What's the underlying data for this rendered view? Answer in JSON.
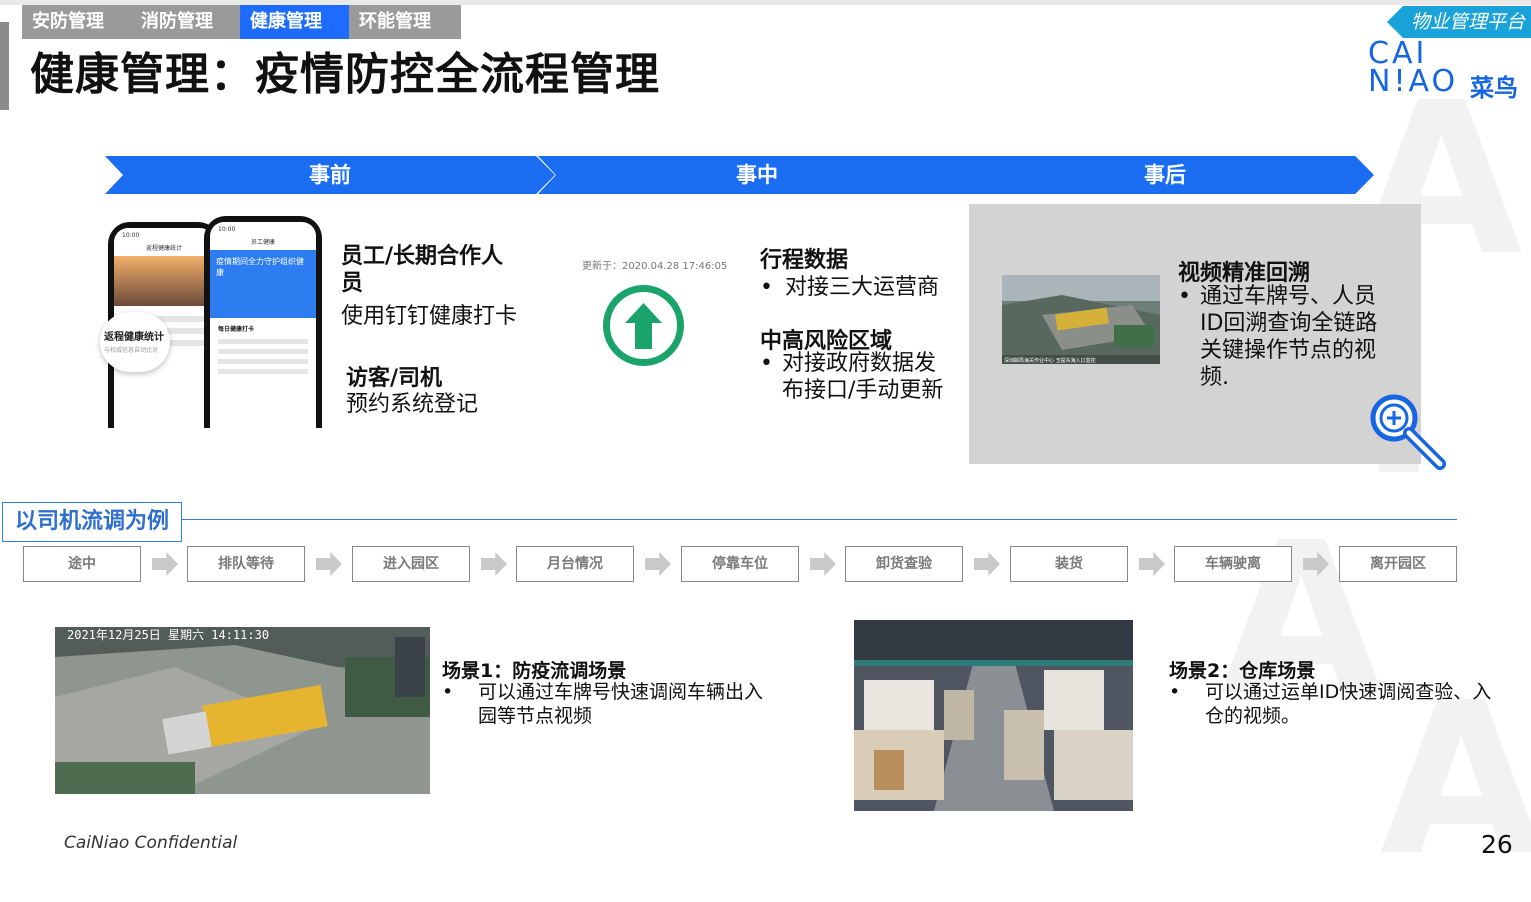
{
  "tabs": [
    "安防管理",
    "消防管理",
    "健康管理",
    "环能管理"
  ],
  "active_tab": "健康管理",
  "title": "健康管理：疫情防控全流程管理",
  "platform_badge": "物业管理平台",
  "logo": {
    "line1": "CAI",
    "line2": "N!AO",
    "cn": "菜鸟"
  },
  "stages": [
    "事前",
    "事中",
    "事后"
  ],
  "before": {
    "item1_title": "员工/长期合作人员",
    "item1_text": "使用钉钉健康打卡",
    "item2_title": "访客/司机",
    "item2_text": "预约系统登记",
    "phone_card_title": "返程健康统计",
    "phone_card_sub": "与权威信息自动比对",
    "phone_banner": "疫情期间全力守护组织健康",
    "phone_header_left": "返程健康统计",
    "phone_header_right": "员工健康",
    "phone_section": "每日健康打卡",
    "phone_time": "10:00"
  },
  "during": {
    "update_time": "更新于：2020.04.28 17:46:05",
    "block1_title": "行程数据",
    "block1_bullets": [
      "对接三大运营商"
    ],
    "block2_title": "中高风险区域",
    "block2_bullets": [
      "对接政府数据发布接口/手动更新"
    ]
  },
  "after": {
    "title": "视频精准回溯",
    "bullets": [
      "通过车牌号、人员ID回溯查询全链路关键操作节点的视频."
    ],
    "thumb_caption": "深圳邮局海关作业中心 玉提东海入口监控"
  },
  "example_label": "以司机流调为例",
  "flow_steps": [
    "途中",
    "排队等待",
    "进入园区",
    "月台情况",
    "停靠车位",
    "卸货查验",
    "装货",
    "车辆驶离",
    "离开园区"
  ],
  "scene1": {
    "title": "场景1：防疫流调场景",
    "bullets": [
      "可以通过车牌号快速调阅车辆出入园等节点视频"
    ],
    "timestamp": "2021年12月25日 星期六 14:11:30"
  },
  "scene2": {
    "title": "场景2：仓库场景",
    "bullets": [
      "可以通过运单ID快速调阅查验、入仓的视频。"
    ]
  },
  "footer": "CaiNiao Confidential",
  "page_number": "26",
  "colors": {
    "brand_blue": "#1a6cf0",
    "tab_gray": "#9a9a9a",
    "success_green": "#1aa36a",
    "badge_cyan": "#1aa3d9"
  }
}
